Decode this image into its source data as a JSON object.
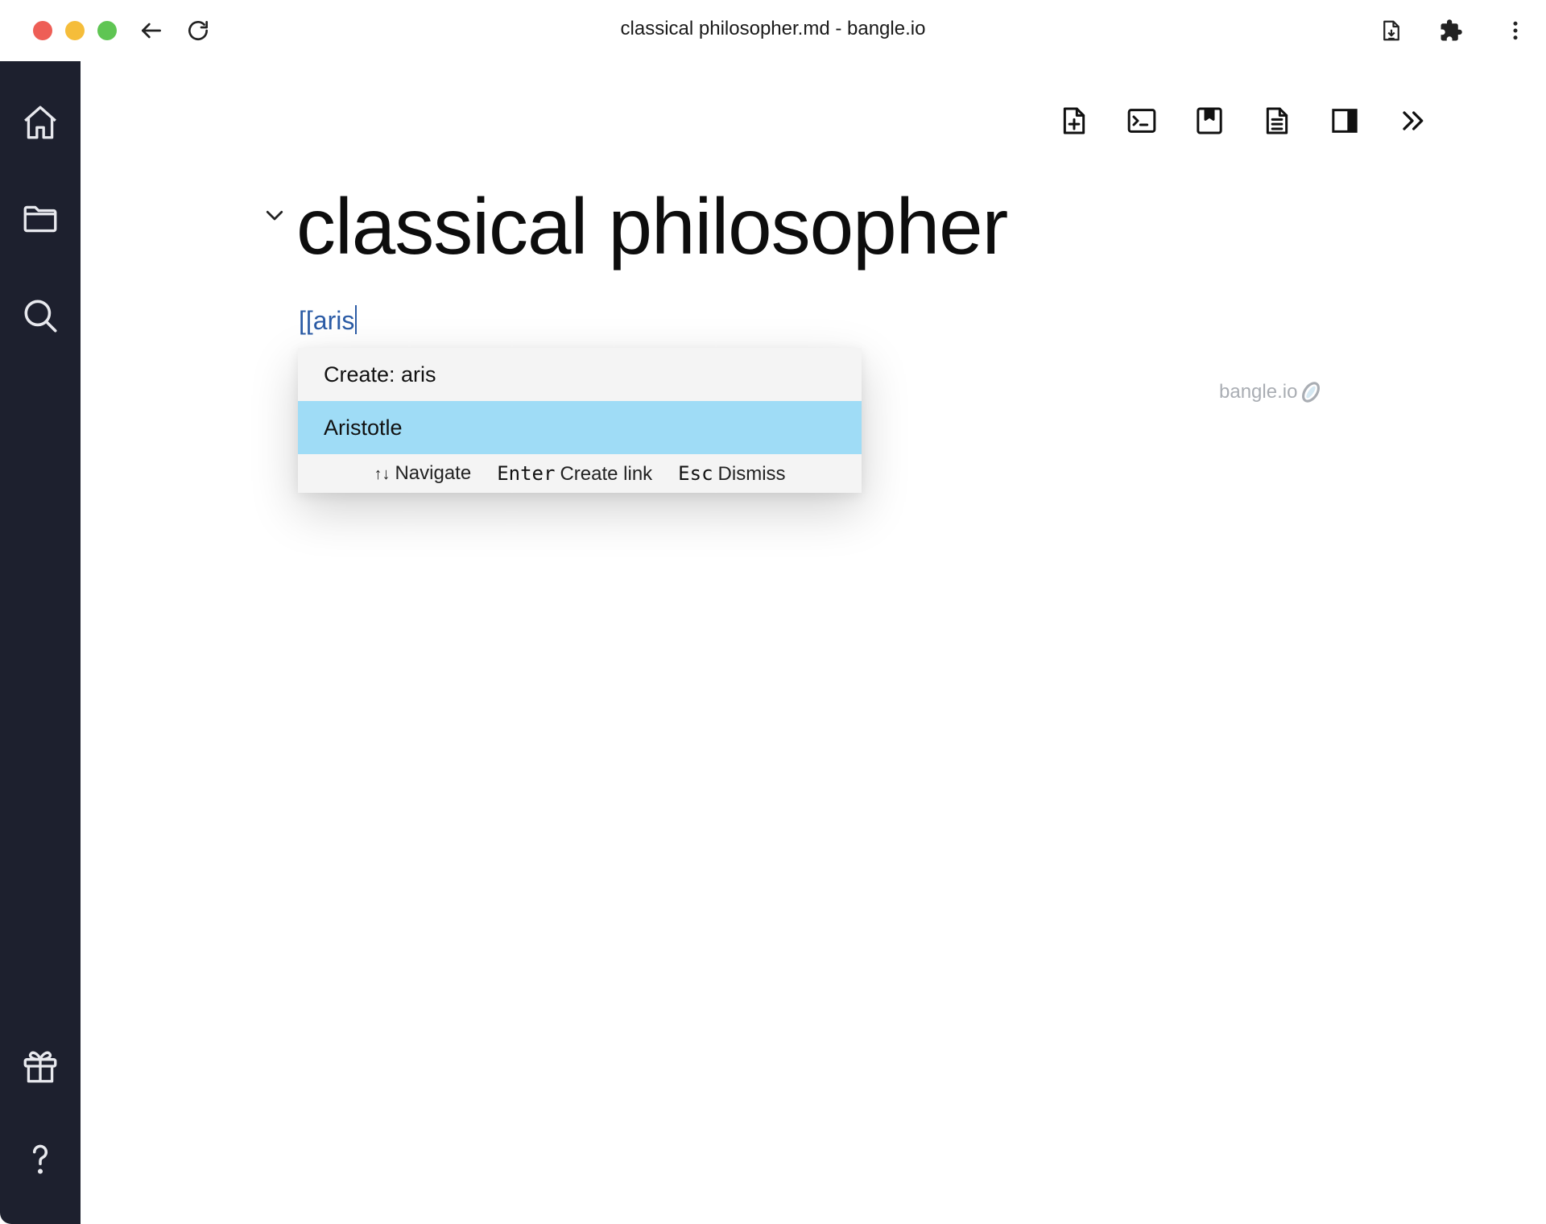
{
  "window": {
    "title": "classical philosopher.md - bangle.io"
  },
  "titlebar": {
    "back_icon": "arrow-left-icon",
    "reload_icon": "reload-icon",
    "right_icons": [
      "file-download-icon",
      "puzzle-extension-icon",
      "kebab-menu-icon"
    ]
  },
  "sidebar": {
    "items": [
      {
        "name": "home",
        "icon": "home-icon"
      },
      {
        "name": "files",
        "icon": "folder-icon"
      },
      {
        "name": "search",
        "icon": "search-icon"
      },
      {
        "name": "whats-new",
        "icon": "gift-icon"
      },
      {
        "name": "help",
        "icon": "question-icon"
      }
    ],
    "background": "#1d202e"
  },
  "toolbar": {
    "items": [
      {
        "name": "new-note",
        "icon": "file-plus-icon"
      },
      {
        "name": "command-palette",
        "icon": "terminal-icon"
      },
      {
        "name": "notes-palette",
        "icon": "bookmark-note-icon"
      },
      {
        "name": "outline",
        "icon": "document-lines-icon"
      },
      {
        "name": "split-screen",
        "icon": "sidebar-right-icon"
      },
      {
        "name": "more",
        "icon": "chevron-double-right-icon"
      }
    ]
  },
  "editor": {
    "heading": "classical philosopher",
    "typed_text": "[[aris",
    "link_color": "#2c5ca6"
  },
  "watermark": {
    "text": "bangle.io"
  },
  "autocomplete": {
    "items": [
      {
        "label": "Create: aris",
        "active": false
      },
      {
        "label": "Aristotle",
        "active": true
      }
    ],
    "active_color": "#9fdcf6",
    "footer": {
      "navigate_key": "↑↓",
      "navigate_label": "Navigate",
      "enter_key": "Enter",
      "enter_label": "Create link",
      "esc_key": "Esc",
      "esc_label": "Dismiss"
    }
  }
}
